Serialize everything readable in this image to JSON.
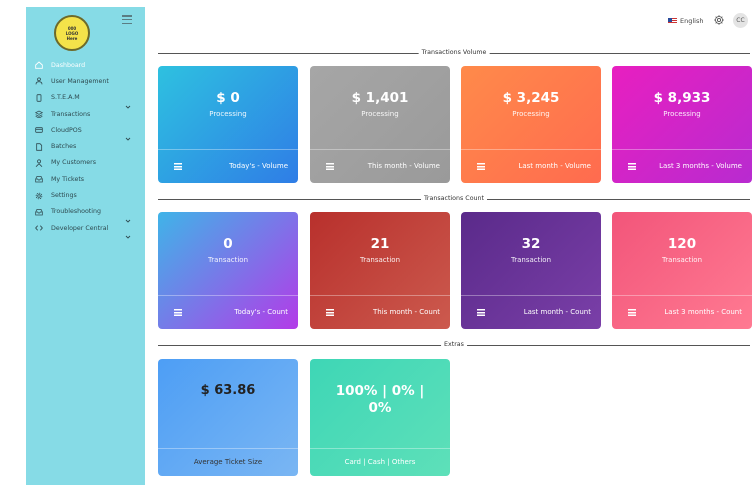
{
  "logo": {
    "lines": [
      "000",
      "LOGO",
      "Here"
    ]
  },
  "sidebar": {
    "items": [
      {
        "label": "Dashboard",
        "icon": "home-icon",
        "active": true,
        "chevron": false
      },
      {
        "label": "User Management",
        "icon": "users-icon",
        "active": false,
        "chevron": false
      },
      {
        "label": "S.T.E.A.M",
        "icon": "mobile-icon",
        "active": false,
        "chevron": true
      },
      {
        "label": "Transactions",
        "icon": "stack-icon",
        "active": false,
        "chevron": false
      },
      {
        "label": "CloudPOS",
        "icon": "credit-card-icon",
        "active": false,
        "chevron": true
      },
      {
        "label": "Batches",
        "icon": "file-icon",
        "active": false,
        "chevron": false
      },
      {
        "label": "My Customers",
        "icon": "user-icon",
        "active": false,
        "chevron": false
      },
      {
        "label": "My Tickets",
        "icon": "inbox-icon",
        "active": false,
        "chevron": false
      },
      {
        "label": "Settings",
        "icon": "gear-icon",
        "active": false,
        "chevron": false
      },
      {
        "label": "Troubleshooting",
        "icon": "inbox-icon",
        "active": false,
        "chevron": true
      },
      {
        "label": "Developer Central",
        "icon": "code-icon",
        "active": false,
        "chevron": true
      }
    ]
  },
  "topbar": {
    "language": "English",
    "avatar_initials": "CC"
  },
  "sections": {
    "volume": "Transactions Volume",
    "count": "Transactions Count",
    "extras": "Extras"
  },
  "volume_cards": [
    {
      "amount": "$ 0",
      "sub": "Processing",
      "footer": "Today's - Volume",
      "color_start": "#2ec1e0",
      "color_end": "#2f7de6"
    },
    {
      "amount": "$ 1,401",
      "sub": "Processing",
      "footer": "This month - Volume",
      "color_start": "#a6a6a6",
      "color_end": "#9a9a9a"
    },
    {
      "amount": "$ 3,245",
      "sub": "Processing",
      "footer": "Last month - Volume",
      "color_start": "#ff8a4a",
      "color_end": "#ff6b4f"
    },
    {
      "amount": "$ 8,933",
      "sub": "Processing",
      "footer": "Last 3 months - Volume",
      "color_start": "#e81fc0",
      "color_end": "#b82bd0"
    }
  ],
  "count_cards": [
    {
      "amount": "0",
      "sub": "Transaction",
      "footer": "Today's - Count",
      "color_start": "#3fb4e8",
      "color_end": "#b33be8"
    },
    {
      "amount": "21",
      "sub": "Transaction",
      "footer": "This month - Count",
      "color_start": "#b8302c",
      "color_end": "#cc5a4e"
    },
    {
      "amount": "32",
      "sub": "Transaction",
      "footer": "Last month - Count",
      "color_start": "#5a2a8a",
      "color_end": "#7a3fa8"
    },
    {
      "amount": "120",
      "sub": "Transaction",
      "footer": "Last 3 months - Count",
      "color_start": "#f2557a",
      "color_end": "#ff7a92"
    }
  ],
  "extras": {
    "avg_ticket": {
      "amount": "$ 63.86",
      "footer": "Average Ticket Size",
      "color_start": "#4d9ef5",
      "color_end": "#7ab6f3"
    },
    "payment_split": {
      "amount": "100% | 0% | 0%",
      "footer": "Card | Cash | Others",
      "color_start": "#3ed6b6",
      "color_end": "#5ee0b9"
    }
  }
}
